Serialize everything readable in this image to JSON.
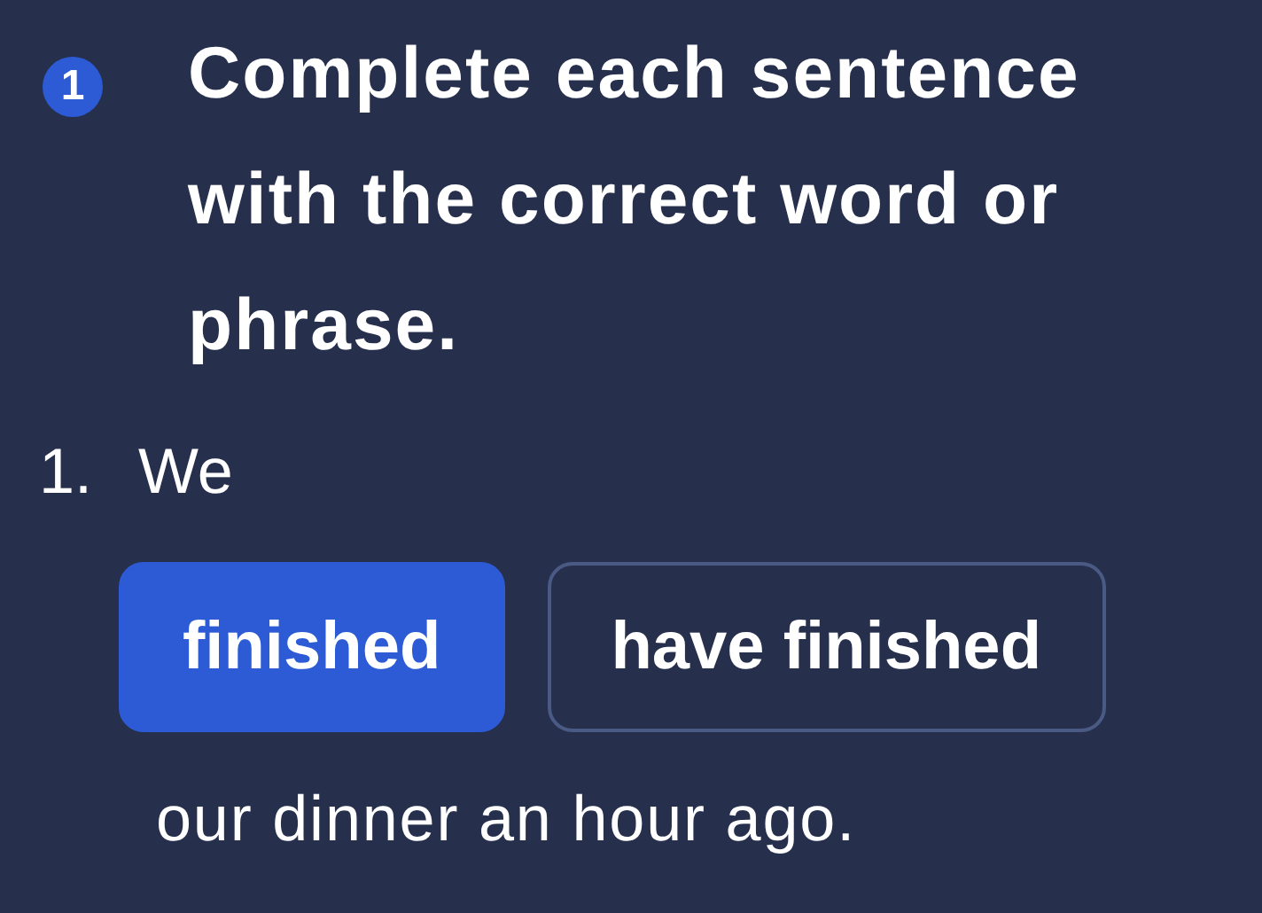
{
  "instruction": {
    "badge": "1",
    "text": "Complete each sentence with the correct word or phrase."
  },
  "question": {
    "number": "1.",
    "before": "We",
    "options": [
      {
        "label": "finished",
        "selected": true
      },
      {
        "label": "have finished",
        "selected": false
      }
    ],
    "after": "our dinner an hour ago."
  }
}
